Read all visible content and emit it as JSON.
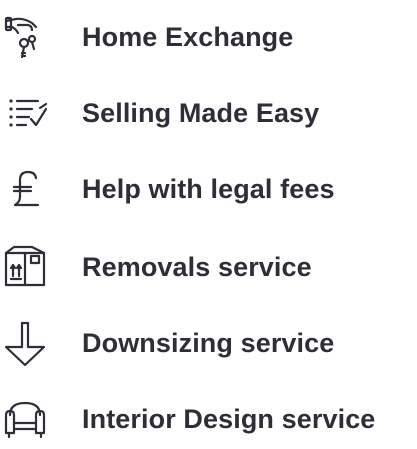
{
  "menu": {
    "items": [
      {
        "label": "Home Exchange",
        "icon": "hand-keys-icon"
      },
      {
        "label": "Selling Made Easy",
        "icon": "checklist-icon"
      },
      {
        "label": "Help with legal fees",
        "icon": "pound-sign-icon"
      },
      {
        "label": "Removals service",
        "icon": "moving-box-icon"
      },
      {
        "label": "Downsizing service",
        "icon": "down-arrow-icon"
      },
      {
        "label": "Interior Design service",
        "icon": "armchair-icon"
      }
    ]
  },
  "colors": {
    "text": "#2e2e39",
    "background": "#ffffff"
  }
}
